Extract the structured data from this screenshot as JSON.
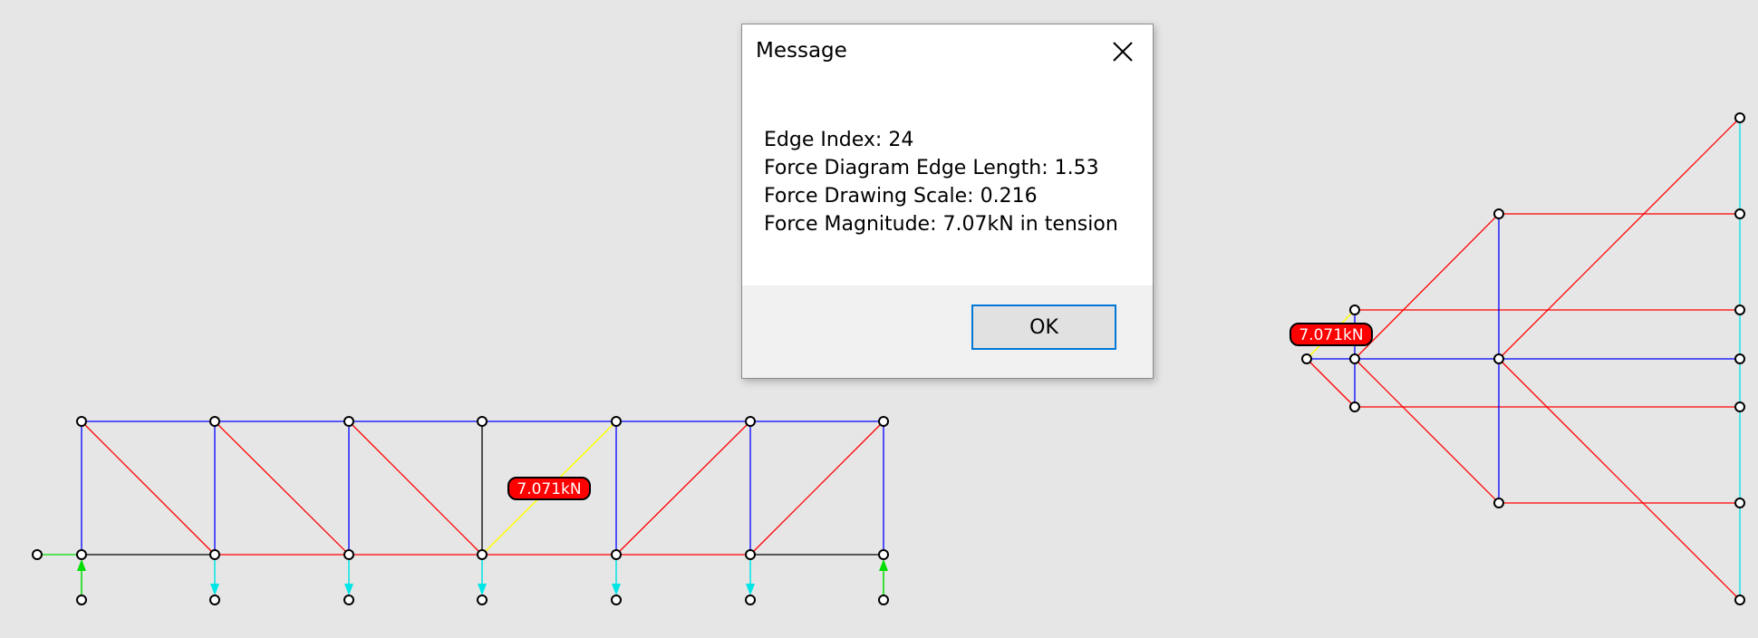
{
  "colors": {
    "background": "#e6e6e6",
    "compression": "#0000ff",
    "tension": "#ff0000",
    "zero": "#000000",
    "selected": "#ffff00",
    "reaction": "#00dd00",
    "load": "#00e5e5",
    "label_bg": "#ff0000"
  },
  "form_diagram_label": "7.071kN",
  "force_diagram_label": "7.071kN",
  "dialog": {
    "title": "Message",
    "lines": [
      "Edge Index: 24",
      "Force Diagram Edge Length: 1.53",
      "Force Drawing Scale: 0.216",
      "Force Magnitude: 7.07kN in tension"
    ],
    "ok_label": "OK",
    "close_icon": "close-icon"
  }
}
